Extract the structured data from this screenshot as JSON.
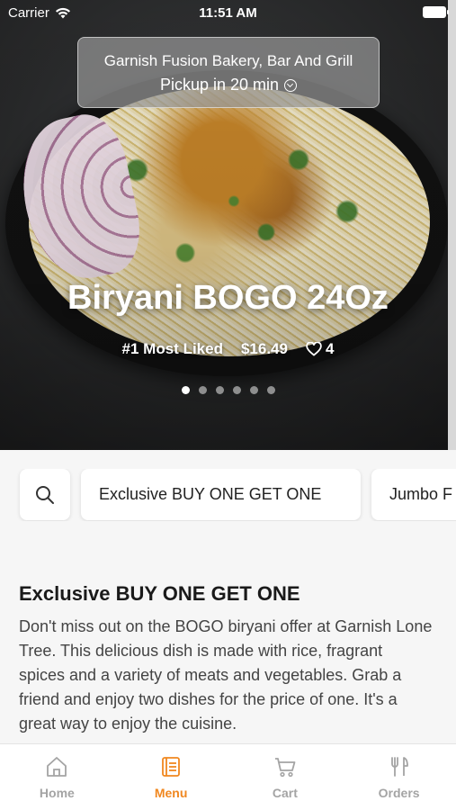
{
  "status_bar": {
    "carrier": "Carrier",
    "time": "11:51 AM"
  },
  "store": {
    "name": "Garnish Fusion Bakery, Bar And Grill",
    "pickup": "Pickup in 20 min"
  },
  "hero": {
    "title": "Biryani BOGO 24Oz",
    "badge": "#1 Most Liked",
    "price": "$16.49",
    "likes": "4",
    "carousel": {
      "count": 6,
      "active_index": 0
    }
  },
  "categories": [
    "Exclusive BUY ONE GET ONE",
    "Jumbo F"
  ],
  "section": {
    "title": "Exclusive BUY ONE GET ONE",
    "description": "Don't miss out on the BOGO biryani offer at Garnish Lone Tree. This delicious dish is made with rice, fragrant spices and a variety of meats and vegetables. Grab a friend and enjoy two dishes for the price of one. It's a great way to enjoy the cuisine."
  },
  "tabs": [
    {
      "label": "Home",
      "icon": "home-icon"
    },
    {
      "label": "Menu",
      "icon": "menu-icon"
    },
    {
      "label": "Cart",
      "icon": "cart-icon"
    },
    {
      "label": "Orders",
      "icon": "fork-knife-icon"
    }
  ],
  "colors": {
    "accent": "#f0871f",
    "inactive": "#a4a4a4"
  }
}
